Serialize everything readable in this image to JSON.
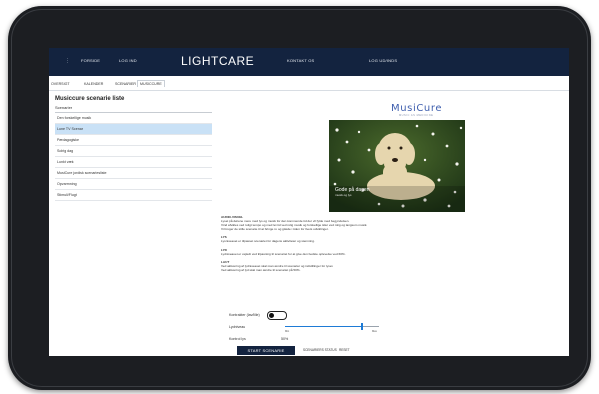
{
  "topbar": {
    "menu_icon": "menu-dots-icon",
    "nav_left": [
      "FORSIDE",
      "LOG IND"
    ],
    "brand": "LIGHTCARE",
    "nav_right": [
      "KONTAKT OS",
      "LOG UD/INDS"
    ]
  },
  "tabs": [
    "OVERSIGT",
    "KALENDER",
    "SCENARIER",
    "MUSICCURE"
  ],
  "sidebar": {
    "title": "Musiccure scenarie liste",
    "subtitle": "Scenarier",
    "items": [
      "Den forskellige musik",
      "Lune TV Scenar",
      "Pædagogiske",
      "Solrig dag",
      "Lunkt væk",
      "MusiCure jordisk scenariesliste",
      "Opvarmning",
      "Stimuli/Flugt"
    ]
  },
  "logo": {
    "text": "MusiCure",
    "sub": "MUSIC AS MEDICINE"
  },
  "photo": {
    "caption": "Gode på dagen",
    "caption_sub": "musik og lys"
  },
  "text_blocks": [
    {
      "heading": "AUDIO-VISUEL",
      "lines": [
        "Lyset på dørene mere med lys og musik for den kommende tid der vil fylde med begyndelsen.",
        "Vind afvikles ved roligt tempo og med let tid ved rolig musik og forskellige tider ved rolig og langsom musik.",
        "Vi bruger de stille scenarie til at bringe ro og glæde i tiden for livets udviklinger."
      ]
    },
    {
      "heading": "LYS",
      "lines": [
        "Lysniveauet er tilpasset scenariet for dagens aktiviteter og stemning."
      ]
    },
    {
      "heading": "LYD",
      "lines": [
        "Lydniveauet er vejledt ved tilpasning til scenariet for at give den bedste oplevelse ved 60%."
      ]
    },
    {
      "heading": "LAUT",
      "lines": [
        "Ved aktivering af lydniveauet skal man ændre til scenarier og indstillinger for lyset.",
        "Ved aktivering af lyd skal man ændre til scenariet på 50%."
      ]
    }
  ],
  "controls": {
    "toggle_label": "Kontrakter (lav/lille)",
    "lyd_label": "Lydniveau",
    "lyd_min": "Min",
    "lyd_max": "Max",
    "lyd_level_percent": 82,
    "control_label": "Kontrol lys",
    "control_value": "50%",
    "start_label": "START SCENARIE",
    "link1": "SCENARIERS STATUS",
    "link2": "RESET"
  },
  "colors": {
    "topbar": "#13233f",
    "accent": "#1e7bd6",
    "selected_row": "#c9e1f6",
    "logo": "#3f5fae"
  }
}
